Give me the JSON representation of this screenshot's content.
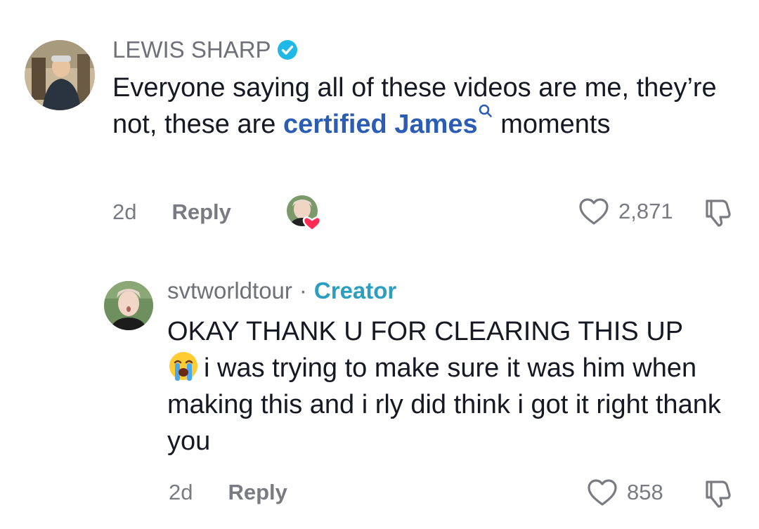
{
  "comments": [
    {
      "author": "LEWIS SHARP",
      "verified": true,
      "text_part1": "Everyone saying all of these videos are me, they’re not, these are ",
      "hashtag": "certified James",
      "text_part2": " moments",
      "time": "2d",
      "reply_label": "Reply",
      "likes": "2,871",
      "liked_by_creator": true
    }
  ],
  "reply": {
    "author": "svtworldtour",
    "separator": "·",
    "badge": "Creator",
    "line1": "OKAY THANK U FOR CLEARING THIS UP",
    "emoji": "loudly-crying-face",
    "text": "i was trying to make sure it was him when making this and i rly did think i got it right thank you",
    "time": "2d",
    "reply_label": "Reply",
    "likes": "858"
  },
  "icons": {
    "verified": "verified-badge-icon",
    "heart": "heart-outline-icon",
    "dislike": "thumbs-down-icon",
    "search": "search-icon"
  },
  "colors": {
    "verified_blue": "#20b8e6",
    "hashtag_blue": "#2b5db5",
    "creator_teal": "#2b9fc2",
    "heart_red": "#fe2c55"
  }
}
